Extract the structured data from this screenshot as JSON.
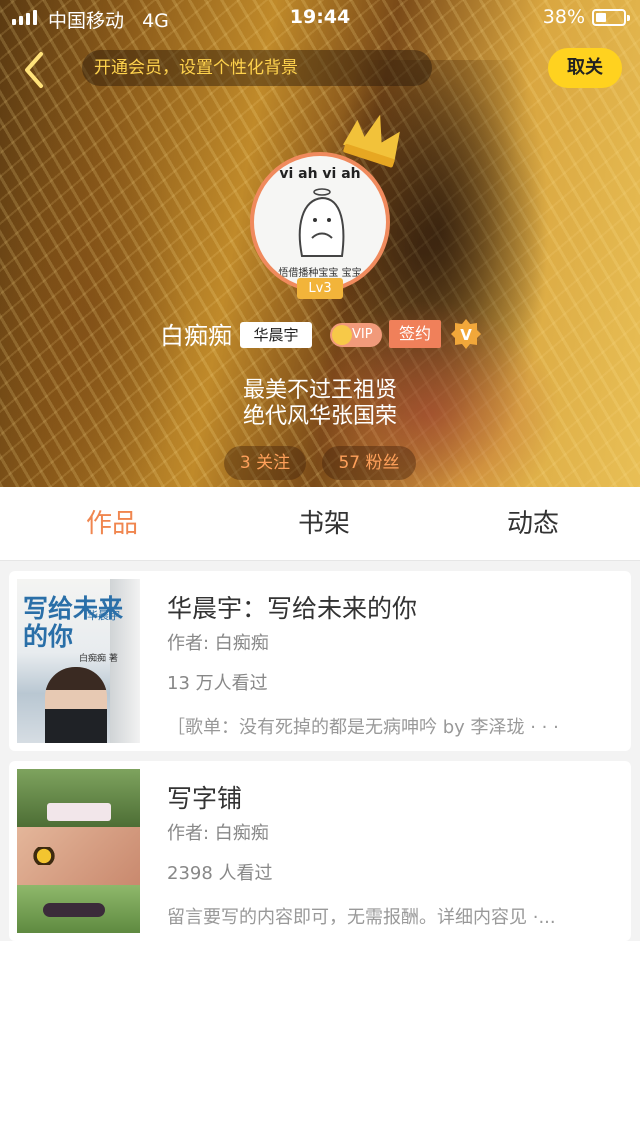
{
  "status_bar": {
    "carrier": "中国移动",
    "network": "4G",
    "time": "19:44",
    "battery": "38%",
    "battery_level": 0.38
  },
  "header": {
    "vip_banner": "开通会员，设置个性化背景",
    "cancel_label": "取关"
  },
  "profile": {
    "avatar_text_top": "vi ah vi ah",
    "avatar_text_bottom": "悟借播种宝宝 宝宝",
    "level": "Lv3",
    "name": "白痴痴",
    "name_tag": "华晨宇",
    "vip_label": "VIP",
    "sign_label": "签约",
    "verified_label": "V",
    "bio_line1": "最美不过王祖贤",
    "bio_line2": "绝代风华张国荣",
    "following": "3 关注",
    "fans": "57 粉丝"
  },
  "tabs": [
    {
      "label": "作品"
    },
    {
      "label": "书架"
    },
    {
      "label": "动态"
    }
  ],
  "works": [
    {
      "title": "华晨宇：写给未来的你",
      "author": "作者: 白痴痴",
      "views": "13 万人看过",
      "desc": "［歌单：没有死掉的都是无病呻吟 by 李泽珑 · · ·",
      "cover_title": "写给未来的你",
      "cover_sub": "华晨宇",
      "cover_author": "白痴痴 著"
    },
    {
      "title": "写字铺",
      "author": "作者: 白痴痴",
      "views": "2398 人看过",
      "desc": "留言要写的内容即可，无需报酬。详细内容见 ·..."
    }
  ],
  "colors": {
    "accent": "#f0864f",
    "cancel_button": "#ffd21f",
    "banner_text": "#ffd34d",
    "stat_text": "#ffa05a"
  }
}
